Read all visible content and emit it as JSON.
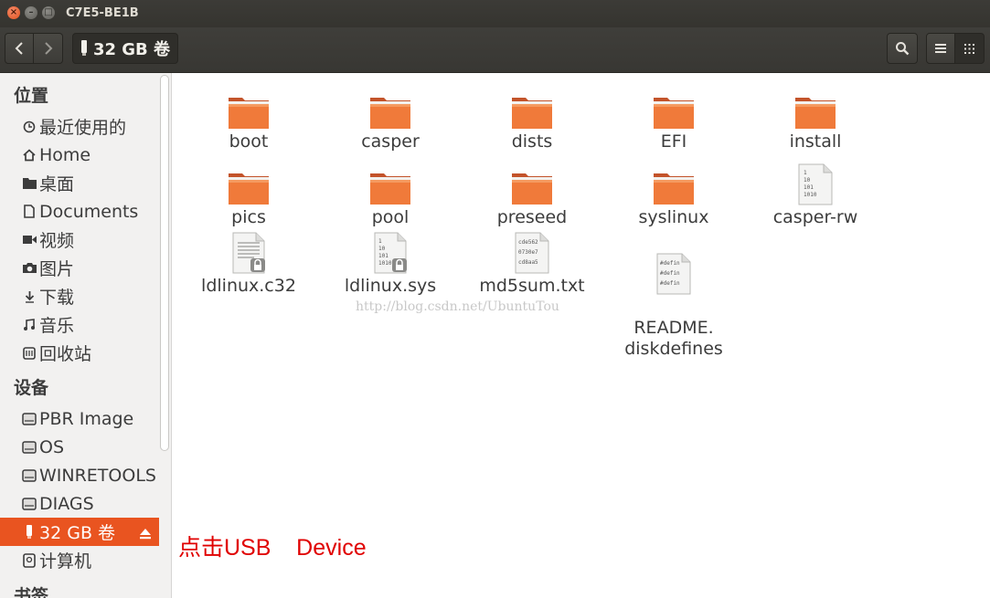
{
  "window": {
    "title": "C7E5-BE1B"
  },
  "toolbar": {
    "path_label": "32 GB 卷"
  },
  "sidebar": {
    "headings": [
      "位置",
      "设备",
      "书签"
    ],
    "places": [
      {
        "label": "最近使用的",
        "icon": "clock-icon"
      },
      {
        "label": "Home",
        "icon": "home-icon"
      },
      {
        "label": "桌面",
        "icon": "folder-icon"
      },
      {
        "label": "Documents",
        "icon": "document-icon"
      },
      {
        "label": "视频",
        "icon": "video-icon"
      },
      {
        "label": "图片",
        "icon": "camera-icon"
      },
      {
        "label": "下载",
        "icon": "download-icon"
      },
      {
        "label": "音乐",
        "icon": "music-icon"
      },
      {
        "label": "回收站",
        "icon": "trash-icon"
      }
    ],
    "devices": [
      {
        "label": "PBR Image",
        "icon": "drive-icon"
      },
      {
        "label": "OS",
        "icon": "drive-icon"
      },
      {
        "label": "WINRETOOLS",
        "icon": "drive-icon"
      },
      {
        "label": "DIAGS",
        "icon": "drive-icon"
      },
      {
        "label": "32 GB 卷",
        "icon": "usb-icon",
        "active": true
      },
      {
        "label": "计算机",
        "icon": "computer-icon"
      }
    ]
  },
  "files": [
    {
      "name": "boot",
      "type": "folder"
    },
    {
      "name": "casper",
      "type": "folder"
    },
    {
      "name": "dists",
      "type": "folder"
    },
    {
      "name": "EFI",
      "type": "folder"
    },
    {
      "name": "install",
      "type": "folder"
    },
    {
      "name": "pics",
      "type": "folder"
    },
    {
      "name": "pool",
      "type": "folder"
    },
    {
      "name": "preseed",
      "type": "folder"
    },
    {
      "name": "syslinux",
      "type": "folder"
    },
    {
      "name": "casper-rw",
      "type": "binary",
      "preview": [
        "1",
        "10",
        "101",
        "1010"
      ]
    },
    {
      "name": "ldlinux.c32",
      "type": "locked-doc"
    },
    {
      "name": "ldlinux.sys",
      "type": "locked-binary",
      "preview": [
        "1",
        "10",
        "101",
        "1010"
      ]
    },
    {
      "name": "md5sum.txt",
      "type": "text",
      "preview": [
        "cde562",
        "0730e7",
        "cd8aa5"
      ]
    },
    {
      "name": "README.\ndiskdefines",
      "type": "text",
      "preview": [
        "#defin",
        "#defin",
        "#defin"
      ]
    }
  ],
  "watermark": "http://blog.csdn.net/UbuntuTou",
  "annotation": "点击USB    Device",
  "colors": {
    "accent": "#e95420",
    "annotation": "#e00000",
    "folder": "#f07a3a"
  }
}
